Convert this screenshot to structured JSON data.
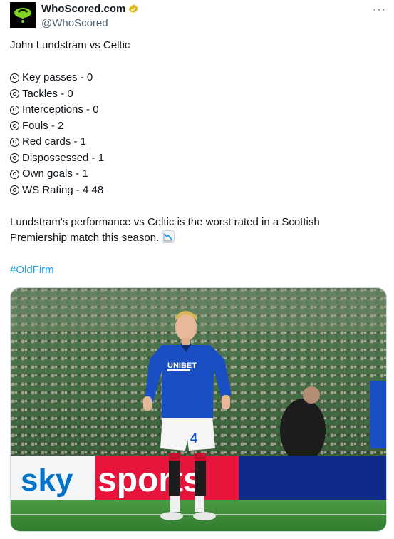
{
  "author": {
    "display_name": "WhoScored.com",
    "handle": "@WhoScored",
    "avatar_icon": "whoscored-logo-icon",
    "verified_icon": "verified-gold-badge-icon",
    "more_icon": "more-options-icon"
  },
  "tweet": {
    "title": "John Lundstram vs Celtic",
    "stat_icon": "bullseye-icon",
    "stats": [
      "Key passes - 0",
      "Tackles - 0",
      "Interceptions - 0",
      "Fouls - 2",
      "Red cards - 1",
      "Dispossessed - 1",
      "Own goals - 1",
      "WS Rating - 4.48"
    ],
    "summary_line1": "Lundstram's performance vs Celtic is the worst rated in a Scottish",
    "summary_line2": "Premiership match this season.",
    "summary_icon": "chart-decreasing-icon",
    "hashtag": "#OldFirm"
  },
  "photo": {
    "jersey_sponsor": "UNIBET",
    "shorts_number": "4",
    "board_left": "sky",
    "board_right": "sports",
    "colors": {
      "rangers_blue": "#1a4fc4",
      "sky_red": "#e8143c",
      "pitch_green": "#3f8a3a",
      "link_blue": "#1d9bf0"
    }
  }
}
